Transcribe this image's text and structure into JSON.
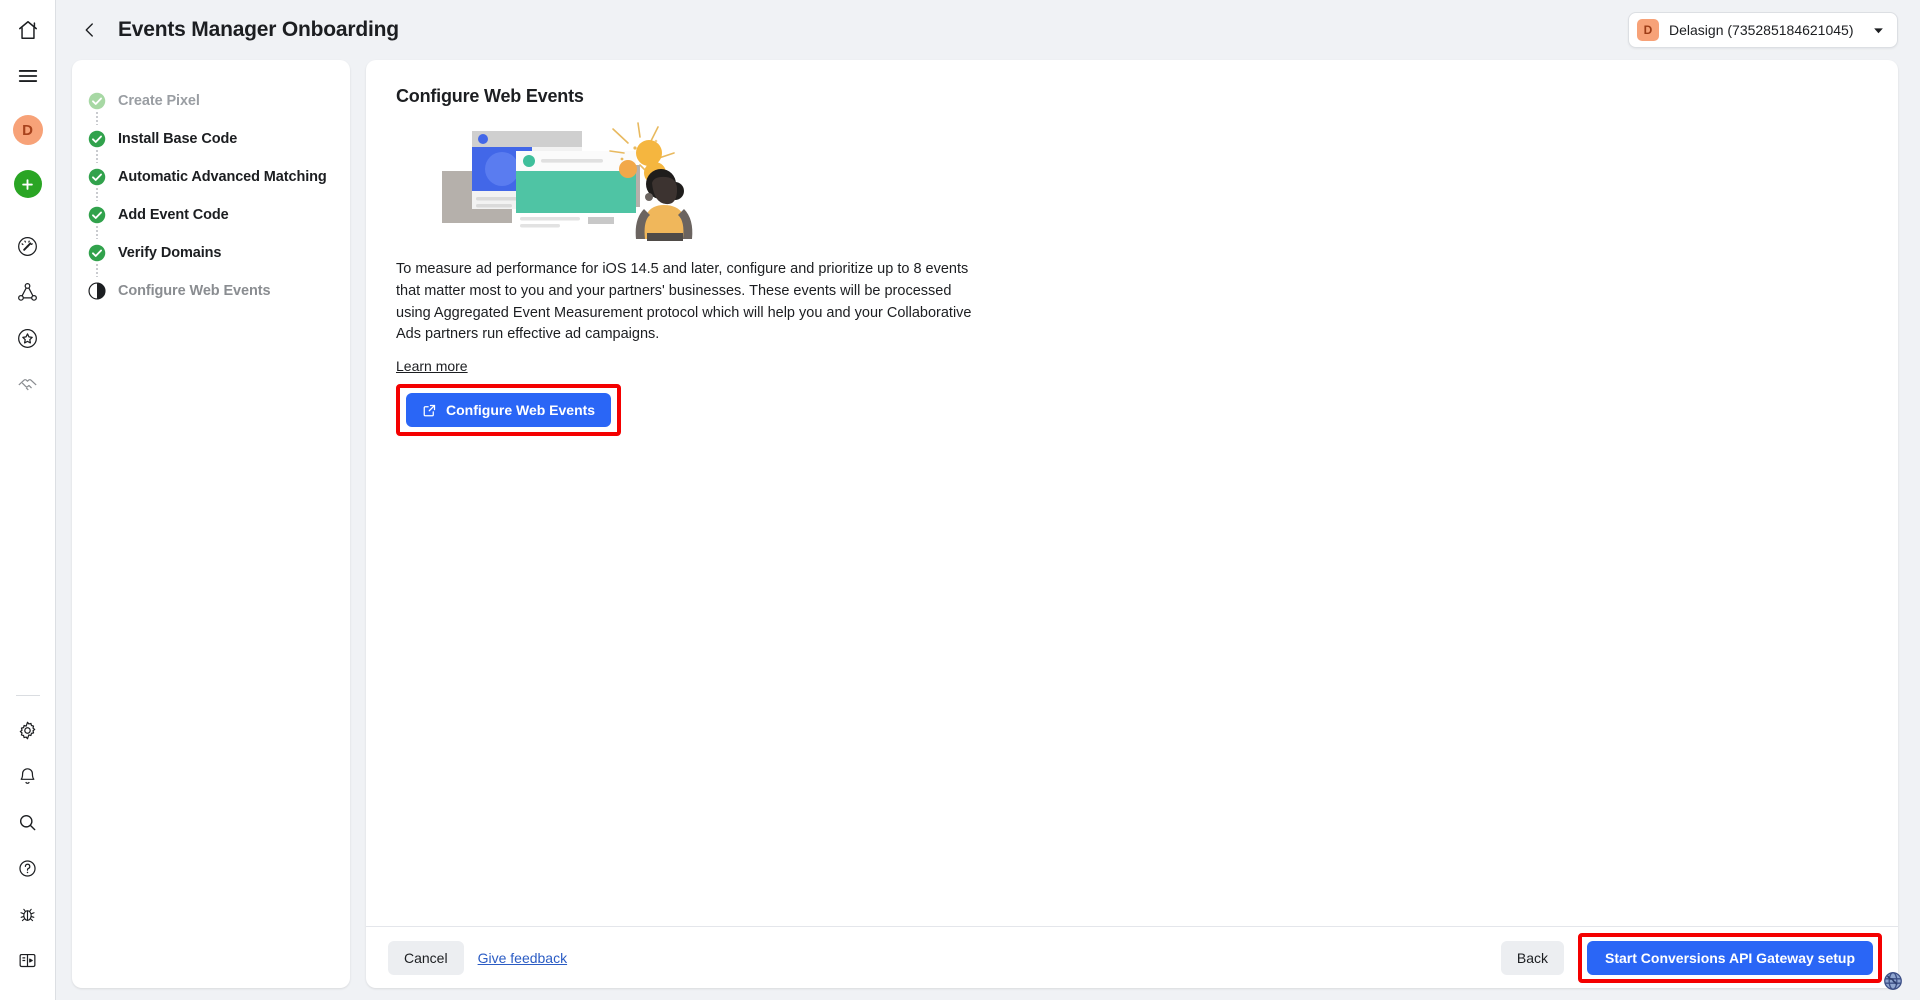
{
  "rail": {
    "icons": [
      {
        "name": "home-icon",
        "label": "Home"
      },
      {
        "name": "menu-icon",
        "label": "Menu"
      },
      {
        "name": "avatar",
        "label": "D"
      },
      {
        "name": "create-icon",
        "label": "Create"
      },
      {
        "name": "ads-manager-icon",
        "label": "Ads Manager"
      },
      {
        "name": "audiences-icon",
        "label": "Audiences"
      },
      {
        "name": "brand-safety-icon",
        "label": "Brand Safety"
      },
      {
        "name": "partnerships-icon",
        "label": "Partnerships"
      },
      {
        "name": "settings-gear-icon",
        "label": "Settings"
      },
      {
        "name": "notifications-bell-icon",
        "label": "Notifications"
      },
      {
        "name": "search-icon",
        "label": "Search"
      },
      {
        "name": "help-icon",
        "label": "Help"
      },
      {
        "name": "bug-icon",
        "label": "Report a bug"
      },
      {
        "name": "panel-toggle-icon",
        "label": "Toggle panel"
      }
    ]
  },
  "header": {
    "back_label": "Back",
    "title": "Events Manager Onboarding",
    "account": {
      "badge": "D",
      "name": "Delasign (735285184621045)",
      "caret": "chevron-down-icon"
    }
  },
  "steps": [
    {
      "label": "Create Pixel",
      "state": "completed-faded"
    },
    {
      "label": "Install Base Code",
      "state": "completed"
    },
    {
      "label": "Automatic Advanced Matching",
      "state": "completed"
    },
    {
      "label": "Add Event Code",
      "state": "completed"
    },
    {
      "label": "Verify Domains",
      "state": "completed"
    },
    {
      "label": "Configure Web Events",
      "state": "current"
    }
  ],
  "panel": {
    "title": "Configure Web Events",
    "body": "To measure ad performance for iOS 14.5 and later, configure and prioritize up to 8 events that matter most to you and your partners' businesses. These events will be processed using Aggregated Event Measurement protocol which will help you and your Collaborative Ads partners run effective ad campaigns.",
    "learn_more": "Learn more",
    "cta_label": "Configure Web Events",
    "cta_icon": "external-link-icon",
    "illustration": "web-events-illustration"
  },
  "footer": {
    "cancel_label": "Cancel",
    "feedback_label": "Give feedback",
    "back_label": "Back",
    "primary_label": "Start Conversions API Gateway setup"
  },
  "colors": {
    "accent_blue": "#2a66f6",
    "highlight_red": "#f40000",
    "success_green": "#2aa524",
    "success_green_faded": "#a3d9a0",
    "avatar_orange": "#f7a278",
    "page_bg": "#f0f2f5",
    "card_bg": "#ffffff",
    "text_primary": "#1c1e21",
    "text_muted": "#8a8d91"
  },
  "corner": {
    "globe_icon": "globe-icon"
  }
}
